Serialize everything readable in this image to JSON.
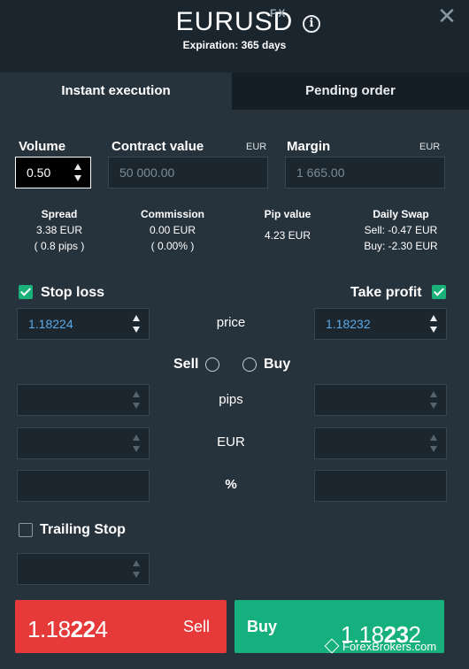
{
  "header": {
    "symbol": "EURUSD",
    "tag": "FX",
    "expiration": "Expiration: 365 days"
  },
  "tabs": [
    {
      "label": "Instant execution",
      "active": true
    },
    {
      "label": "Pending order",
      "active": false
    }
  ],
  "volume": {
    "label": "Volume",
    "value": "0.50"
  },
  "contract_value": {
    "label": "Contract value",
    "currency": "EUR",
    "value": "50 000.00"
  },
  "margin": {
    "label": "Margin",
    "currency": "EUR",
    "value": "1 665.00"
  },
  "stats": {
    "spread": {
      "label": "Spread",
      "line1": "3.38 EUR",
      "line2": "( 0.8 pips )"
    },
    "commission": {
      "label": "Commission",
      "line1": "0.00 EUR",
      "line2": "( 0.00% )"
    },
    "pip_value": {
      "label": "Pip value",
      "line1": "4.23 EUR"
    },
    "daily_swap": {
      "label": "Daily Swap",
      "line1": "Sell: -0.47 EUR",
      "line2": "Buy: -2.30 EUR"
    }
  },
  "stop_loss": {
    "label": "Stop loss",
    "checked": true,
    "price": "1.18224"
  },
  "take_profit": {
    "label": "Take profit",
    "checked": true,
    "price": "1.18232"
  },
  "rows": {
    "price": "price",
    "pips": "pips",
    "eur": "EUR",
    "percent": "%"
  },
  "direction": {
    "sell": "Sell",
    "buy": "Buy"
  },
  "trailing_stop": {
    "label": "Trailing Stop",
    "checked": false
  },
  "sell_button": {
    "price_prefix": "1.18",
    "price_big": "22",
    "price_suffix": "4",
    "label": "Sell",
    "color": "#e63a3a"
  },
  "buy_button": {
    "label": "Buy",
    "price_prefix": "1.18",
    "price_big": "23",
    "price_suffix": "2",
    "color": "#16b07e"
  },
  "watermark": "ForexBrokers.com"
}
